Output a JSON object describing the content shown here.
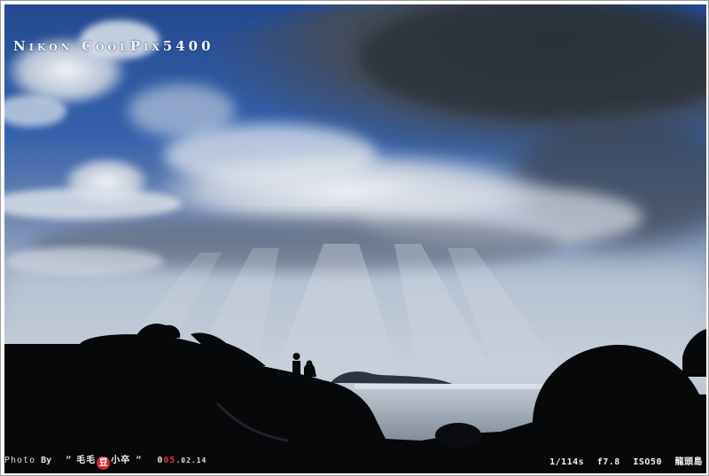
{
  "photo": {
    "scene": "silhouette-coast-sunrays",
    "colors": {
      "sky_blue": "#2f5ca8",
      "cloud_dark": "#3b4350",
      "cloud_light": "#e7eaee",
      "haze": "#b9c4d2",
      "sea": "#aeb8c4",
      "silhouette": "#07080a"
    }
  },
  "camera_label": "Nikon CoolPix5400",
  "credit": {
    "label": "Photo",
    "by": "By",
    "quote_open": "”",
    "name_part1": "毛毛",
    "badge": "豆",
    "name_part2": "小卒",
    "quote_close": "”",
    "date_red_prefix": "0",
    "date_red": "05",
    "date_rest": ".02.14"
  },
  "exif": {
    "shutter": "1/114s",
    "aperture": "f7.8",
    "iso": "ISO50",
    "location": "龍頭島"
  }
}
